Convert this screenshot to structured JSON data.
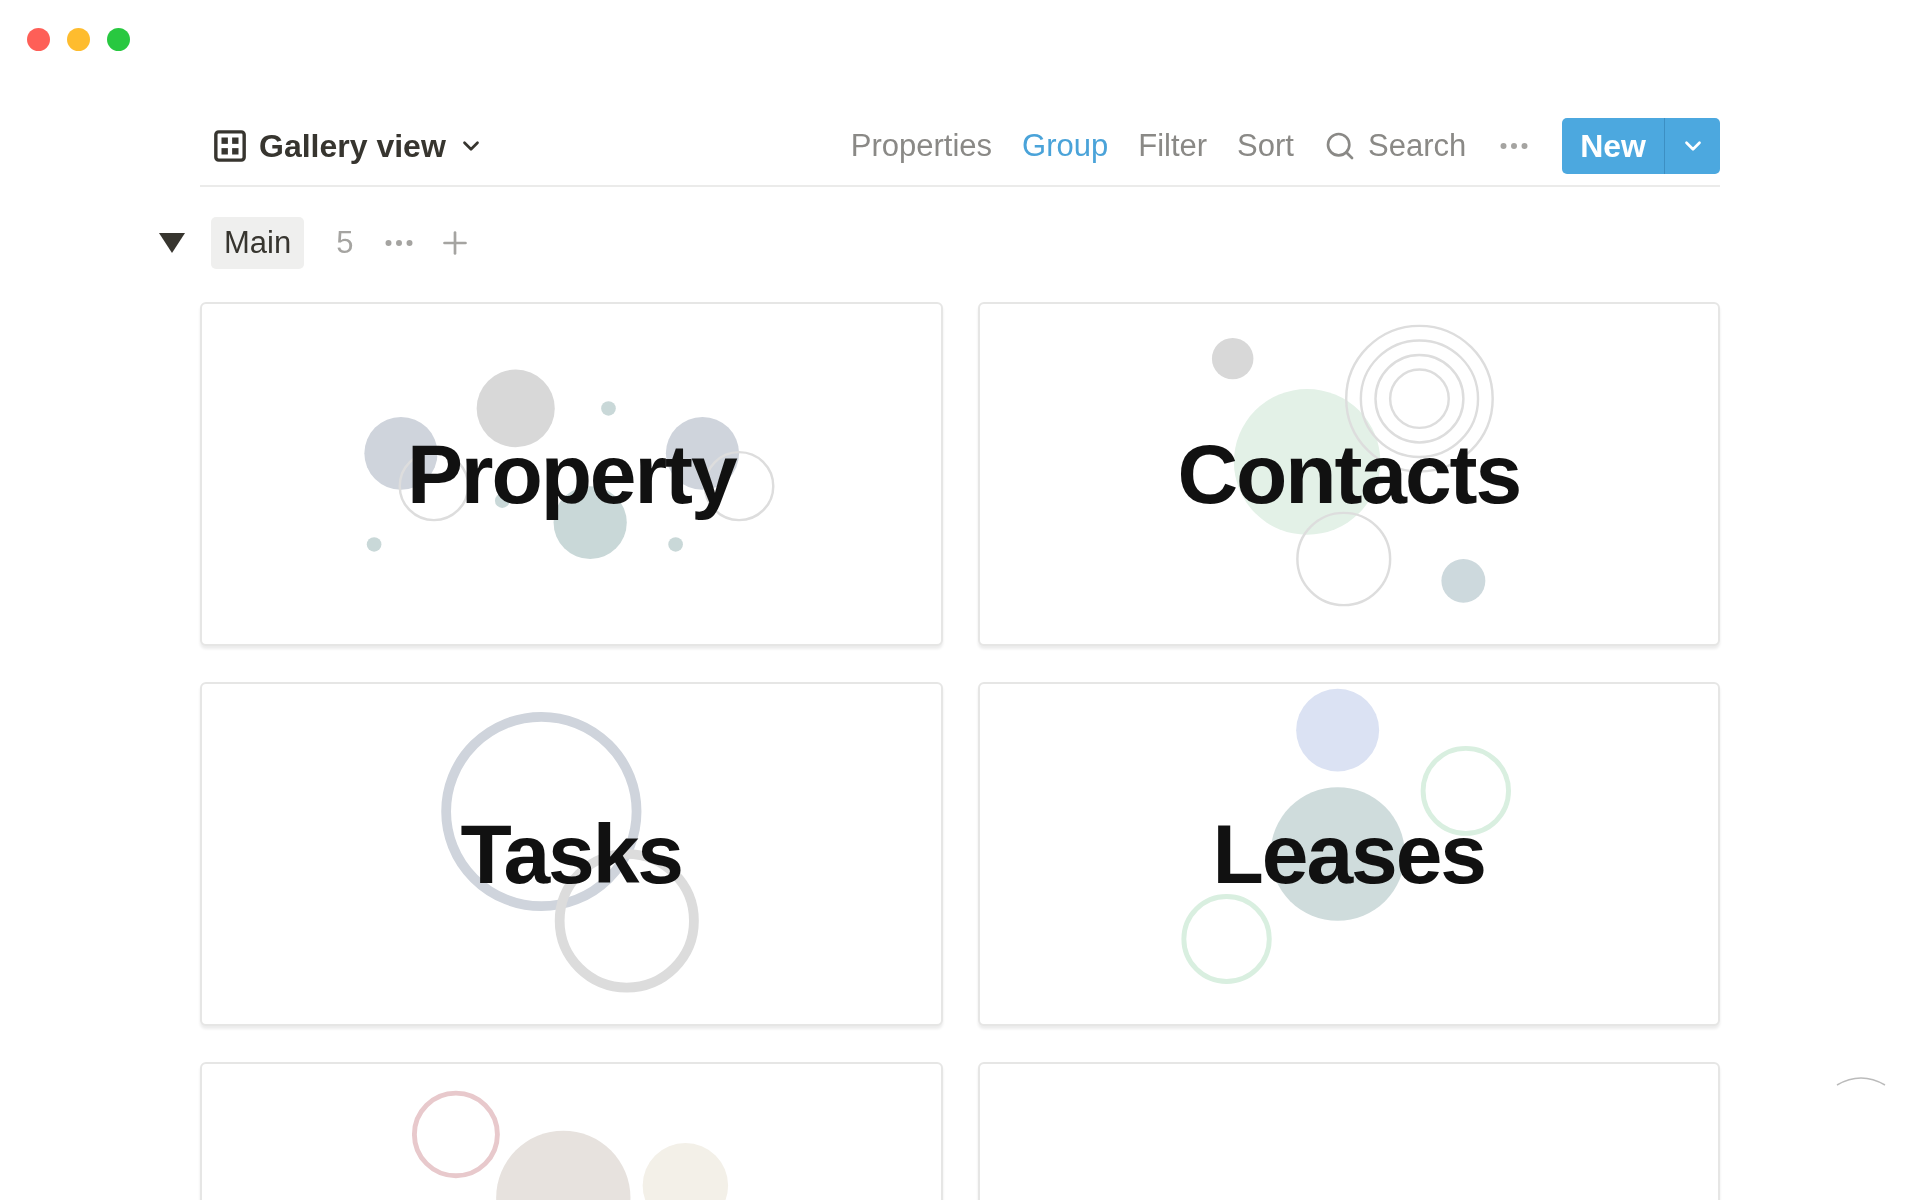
{
  "view": {
    "title": "Gallery view"
  },
  "toolbar": [
    {
      "label": "Properties",
      "selected": false
    },
    {
      "label": "Group",
      "selected": true
    },
    {
      "label": "Filter",
      "selected": false
    },
    {
      "label": "Sort",
      "selected": false
    }
  ],
  "search": {
    "label": "Search"
  },
  "new_button": {
    "label": "New"
  },
  "group": {
    "name": "Main",
    "count": "5",
    "expanded": true
  },
  "cards": [
    {
      "kind": "titled",
      "title": "Property"
    },
    {
      "kind": "titled",
      "title": "Contacts"
    },
    {
      "kind": "titled",
      "title": "Tasks"
    },
    {
      "kind": "titled",
      "title": "Leases"
    },
    {
      "kind": "blank"
    },
    {
      "kind": "blank"
    }
  ]
}
